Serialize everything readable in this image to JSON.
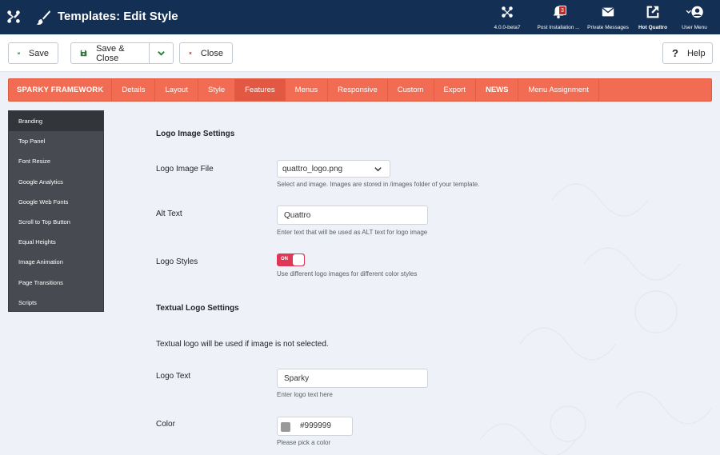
{
  "header": {
    "title": "Templates: Edit Style",
    "items": [
      {
        "name": "version",
        "label": "4.0.0-beta7"
      },
      {
        "name": "post-installation",
        "label": "Post Installation ...",
        "badge": "3"
      },
      {
        "name": "private-messages",
        "label": "Private Messages"
      },
      {
        "name": "hot-quattro",
        "label": "Hot Quattro"
      },
      {
        "name": "user-menu",
        "label": "User Menu"
      }
    ],
    "colors": {
      "bar": "#132f53"
    }
  },
  "toolbar": {
    "save_label": "Save",
    "save_close_label": "Save & Close",
    "close_label": "Close",
    "help_label": "Help"
  },
  "tabs": {
    "brand": "SPARKY FRAMEWORK",
    "items": [
      "Details",
      "Layout",
      "Style",
      "Features",
      "Menus",
      "Responsive",
      "Custom",
      "Export",
      "NEWS",
      "Menu Assignment"
    ],
    "active": "Features",
    "color": "#f26c53"
  },
  "sidebar": {
    "items": [
      "Branding",
      "Top Panel",
      "Font Resize",
      "Google Analytics",
      "Google Web Fonts",
      "Scroll to Top Button",
      "Equal Heights",
      "Image Animation",
      "Page Transitions",
      "Scripts"
    ],
    "active": "Branding"
  },
  "form": {
    "logo_image_heading": "Logo Image Settings",
    "logo_image_file": {
      "label": "Logo Image File",
      "value": "quattro_logo.png",
      "hint": "Select and image. Images are stored in /images folder of your template."
    },
    "alt_text": {
      "label": "Alt Text",
      "value": "Quattro",
      "hint": "Enter text that will be used as ALT text for logo image"
    },
    "logo_styles": {
      "label": "Logo Styles",
      "toggle": "ON",
      "hint": "Use different logo images for different color styles"
    },
    "textual_heading": "Textual Logo Settings",
    "textual_note": "Textual logo will be used if image is not selected.",
    "logo_text": {
      "label": "Logo Text",
      "value": "Sparky",
      "hint": "Enter logo text here"
    },
    "color": {
      "label": "Color",
      "value": "#999999",
      "hint": "Please pick a color"
    }
  }
}
